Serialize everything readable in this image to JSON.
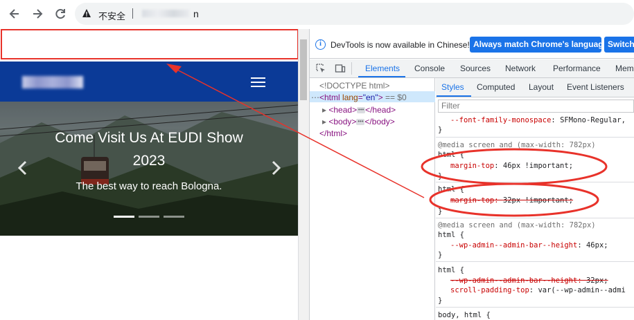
{
  "browser": {
    "back_icon": "arrow-left-icon",
    "forward_icon": "arrow-right-icon",
    "reload_icon": "reload-icon",
    "warning_icon": "warning-triangle-icon",
    "security_label": "不安全",
    "url_tail": "n"
  },
  "website": {
    "header_color": "#0b3a97",
    "menu_icon": "hamburger-icon",
    "hero": {
      "title": "Come Visit Us At EUDI Show 2023",
      "subtitle": "The best way to reach Bologna.",
      "prev_icon": "chevron-left-icon",
      "next_icon": "chevron-right-icon",
      "slides": 3,
      "active_slide": 1
    }
  },
  "annotation": {
    "color": "#e8322a"
  },
  "devtools": {
    "infobar": {
      "message": "DevTools is now available in Chinese!",
      "match_button": "Always match Chrome's language",
      "switch_button": "Switch"
    },
    "tabs": [
      {
        "label": "Elements",
        "active": true
      },
      {
        "label": "Console",
        "active": false
      },
      {
        "label": "Sources",
        "active": false
      },
      {
        "label": "Network",
        "active": false
      },
      {
        "label": "Performance",
        "active": false
      },
      {
        "label": "Mem",
        "active": false
      }
    ],
    "dom": {
      "doctype": "<!DOCTYPE html>",
      "html_open": "<html",
      "lang_attr": "lang",
      "lang_value": "\"en\"",
      "html_close_bracket": ">",
      "selected_marker": "== $0",
      "head_open": "<head>",
      "head_close": "</head>",
      "body_open": "<body>",
      "body_close": "</body>",
      "html_close": "</html>"
    },
    "styles_tabs": [
      {
        "label": "Styles",
        "active": true
      },
      {
        "label": "Computed",
        "active": false
      },
      {
        "label": "Layout",
        "active": false
      },
      {
        "label": "Event Listeners",
        "active": false
      }
    ],
    "filter_placeholder": "Filter",
    "rules": {
      "r0_prop": "--font-family-monospace",
      "r0_val": "SFMono-Regular,",
      "brace_close": "}",
      "media_keyword": "@media",
      "media_query": "screen and (max-width: 782px)",
      "html_selector_open": "html {",
      "r1_prop": "margin-top",
      "r1_val": "46px !important;",
      "r2_prop": "margin-top",
      "r2_val": "32px !important;",
      "r3_prop": "--wp-admin--admin-bar--height",
      "r3_val": "46px;",
      "r4_prop": "--wp-admin--admin-bar--height",
      "r4_val": "32px;",
      "r5_prop": "scroll-padding-top",
      "r5_val": "var(--wp-admin--admi",
      "last_selector": "body, html {"
    }
  }
}
